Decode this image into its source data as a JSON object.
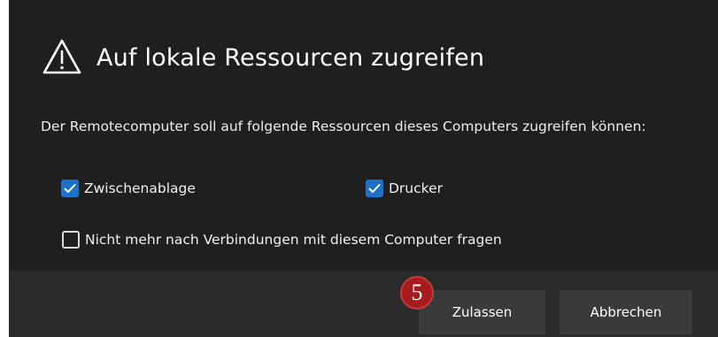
{
  "dialog": {
    "title": "Auf lokale Ressourcen zugreifen",
    "description": "Der Remotecomputer soll auf folgende Ressourcen dieses Computers zugreifen können:",
    "checkboxes": [
      {
        "label": "Zwischenablage",
        "checked": true
      },
      {
        "label": "Drucker",
        "checked": true
      },
      {
        "label": "Nicht mehr nach Verbindungen mit diesem Computer fragen",
        "checked": false
      }
    ],
    "buttons": {
      "allow_label": "Zulassen",
      "cancel_label": "Abbrechen"
    },
    "step_badge": "5"
  },
  "colors": {
    "background": "#1f1f1f",
    "footer": "#2b2b2b",
    "button": "#3a3a3a",
    "checkbox_accent": "#1a73c9",
    "badge": "#a61b1b"
  },
  "icons": {
    "title_icon": "warning-icon",
    "check_icon": "checkmark-icon"
  }
}
